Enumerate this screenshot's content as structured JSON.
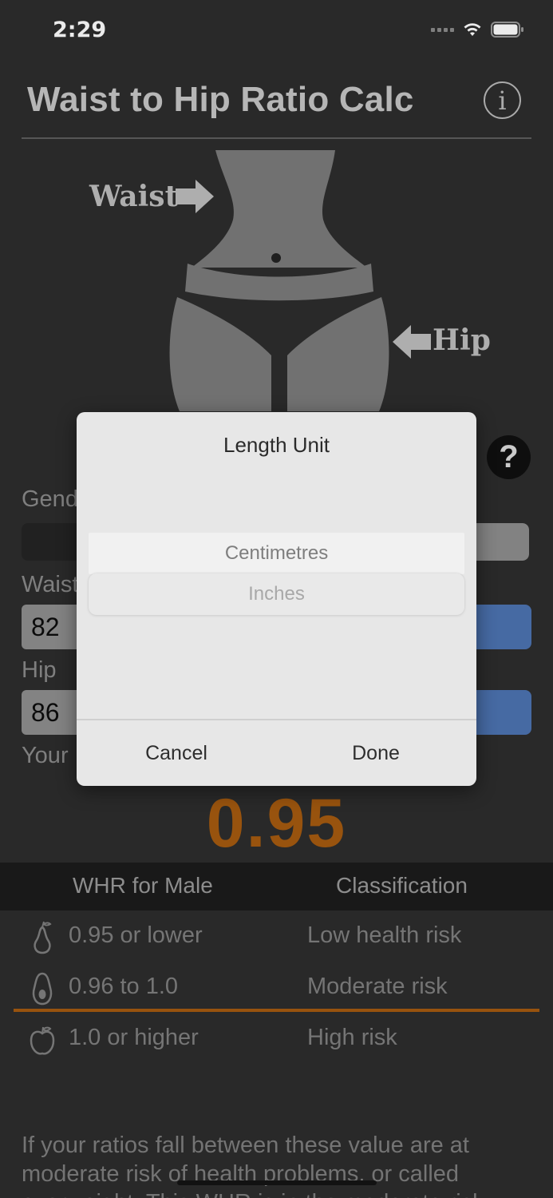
{
  "status_bar": {
    "time": "2:29"
  },
  "header": {
    "title": "Waist to Hip Ratio Calc",
    "info_glyph": "i"
  },
  "illustration": {
    "waist_label": "Waist",
    "hip_label": "Hip"
  },
  "help_glyph": "?",
  "form": {
    "gender_label": "Gend",
    "waist_label": "Waist",
    "waist_value": "82",
    "hip_label": "Hip",
    "hip_value": "86",
    "result_label": "Your"
  },
  "result_value": "0.95",
  "table": {
    "headers": [
      "WHR for Male",
      "Classification"
    ],
    "rows": [
      {
        "icon": "pear-icon",
        "range": "0.95 or lower",
        "classification": "Low health risk"
      },
      {
        "icon": "avocado-icon",
        "range": "0.96 to 1.0",
        "classification": "Moderate risk"
      },
      {
        "icon": "apple-icon",
        "range": "1.0 or higher",
        "classification": "High risk"
      }
    ]
  },
  "explanation": "If your ratios fall between these value are at moderate risk of health problems, or called overweight. This WHR is in the moderate risk",
  "dialog": {
    "title": "Length Unit",
    "options": [
      "Centimetres",
      "Inches"
    ],
    "selected": "Inches",
    "cancel_label": "Cancel",
    "done_label": "Done"
  },
  "colors": {
    "accent_orange": "#a55b10",
    "unit_blue": "#4d73b1",
    "background": "#2d2d2d"
  }
}
